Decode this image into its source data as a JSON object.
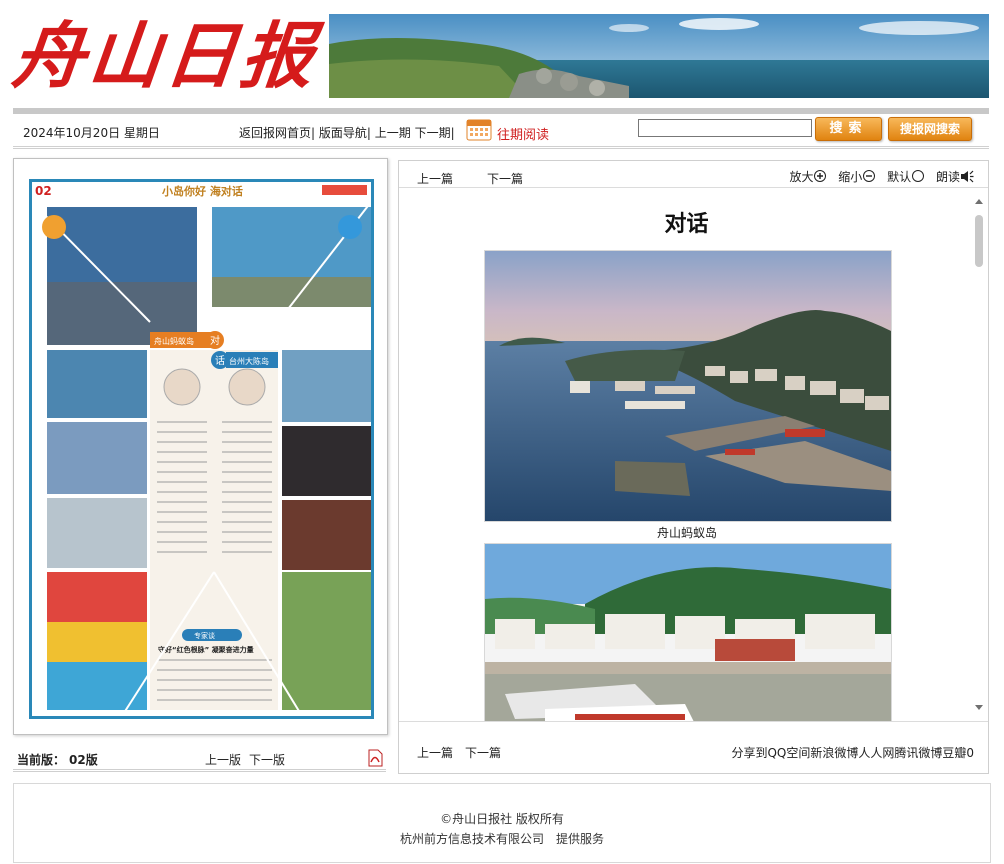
{
  "header": {
    "logo_text": "舟山日报"
  },
  "navbar": {
    "date": "2024年10月20日 星期日",
    "links": [
      "返回报网首页|",
      "版面导航|",
      "上一期",
      "下一期|"
    ],
    "past_reading": "往期阅读",
    "search_placeholder": "",
    "search_button": "搜索",
    "site_search_button": "搜报网搜索"
  },
  "left_panel": {
    "current_label": "当前版：",
    "current_page": "02版",
    "prev_page": "上一版",
    "next_page": "下一版",
    "thumbnail": {
      "page_no": "02",
      "headline": "小岛你好 海对话",
      "left_tag": "舟山蚂蚁岛",
      "right_tag": "台州大陈岛",
      "dui": "对",
      "hua": "话",
      "bottom_tag": "专家谈",
      "bottom_title": "守好“红色根脉” 凝聚奋进力量"
    }
  },
  "right_panel": {
    "prev_article": "上一篇",
    "next_article": "下一篇",
    "zoom_in": "放大",
    "zoom_out": "缩小",
    "default": "默认",
    "read_aloud": "朗读",
    "article_title": "对话",
    "caption1": "舟山蚂蚁岛",
    "share_text": "分享到QQ空间新浪微博人人网腾讯微博豆瓣0"
  },
  "footer": {
    "copyright": "©舟山日报社 版权所有",
    "provider": "杭州前方信息技术有限公司　提供服务"
  }
}
